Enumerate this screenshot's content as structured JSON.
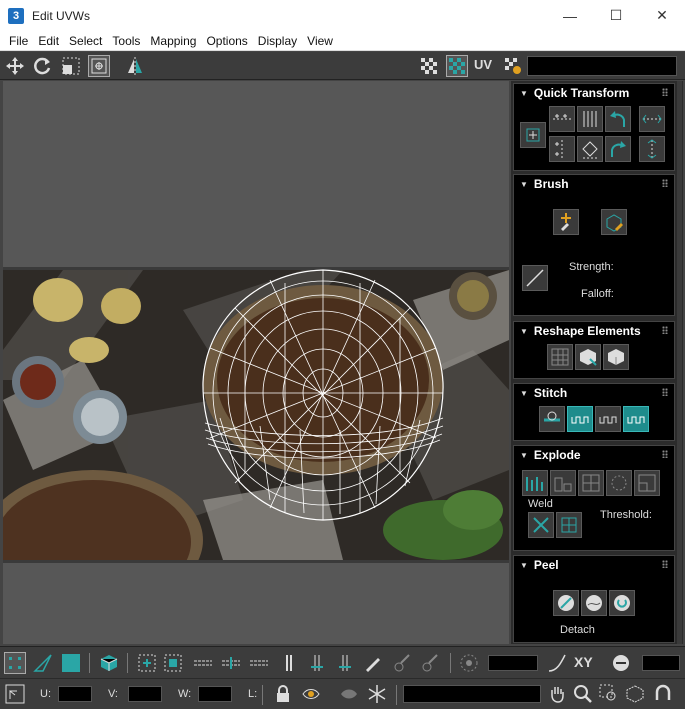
{
  "window": {
    "title": "Edit UVWs",
    "app_icon_glyph": "3",
    "minimize": "—",
    "maximize": "☐",
    "close": "✕"
  },
  "menu": [
    "File",
    "Edit",
    "Select",
    "Tools",
    "Mapping",
    "Options",
    "Display",
    "View"
  ],
  "toolbar": {
    "uv_label": "UV"
  },
  "panel": {
    "quick_transform": {
      "title": "Quick Transform"
    },
    "brush": {
      "title": "Brush",
      "strength_label": "Strength:",
      "falloff_label": "Falloff:"
    },
    "reshape": {
      "title": "Reshape Elements"
    },
    "stitch": {
      "title": "Stitch"
    },
    "explode": {
      "title": "Explode",
      "weld_label": "Weld",
      "threshold_label": "Threshold:"
    },
    "peel": {
      "title": "Peel",
      "detach_label": "Detach"
    }
  },
  "bottom": {
    "xy_label": "XY",
    "u_label": "U:",
    "v_label": "V:",
    "w_label": "W:",
    "l_label": "L:"
  },
  "colors": {
    "accent_teal": "#2aa6a6",
    "panel_bg": "#000000",
    "viewport_bg": "#575757"
  }
}
